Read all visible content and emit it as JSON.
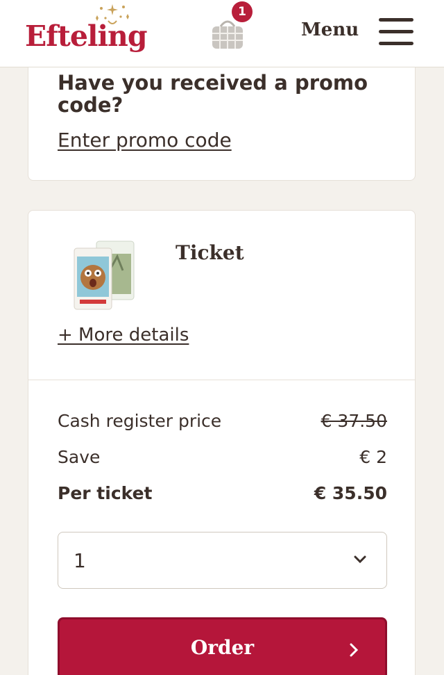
{
  "header": {
    "logo_text": "Efteling",
    "cart_count": "1",
    "menu_label": "Menu"
  },
  "promo": {
    "title": "Have you received a promo code?",
    "link": "Enter promo code"
  },
  "ticket": {
    "title": "Ticket",
    "more_details": "+ More details",
    "prices": [
      {
        "label": "Cash register price",
        "value": "€ 37.50"
      },
      {
        "label": "Save",
        "value": "€ 2"
      },
      {
        "label": "Per ticket",
        "value": "€ 35.50"
      }
    ],
    "quantity": "1",
    "order_label": "Order"
  },
  "colors": {
    "brand_red": "#b5163a",
    "text_brown": "#3b2f2a"
  }
}
